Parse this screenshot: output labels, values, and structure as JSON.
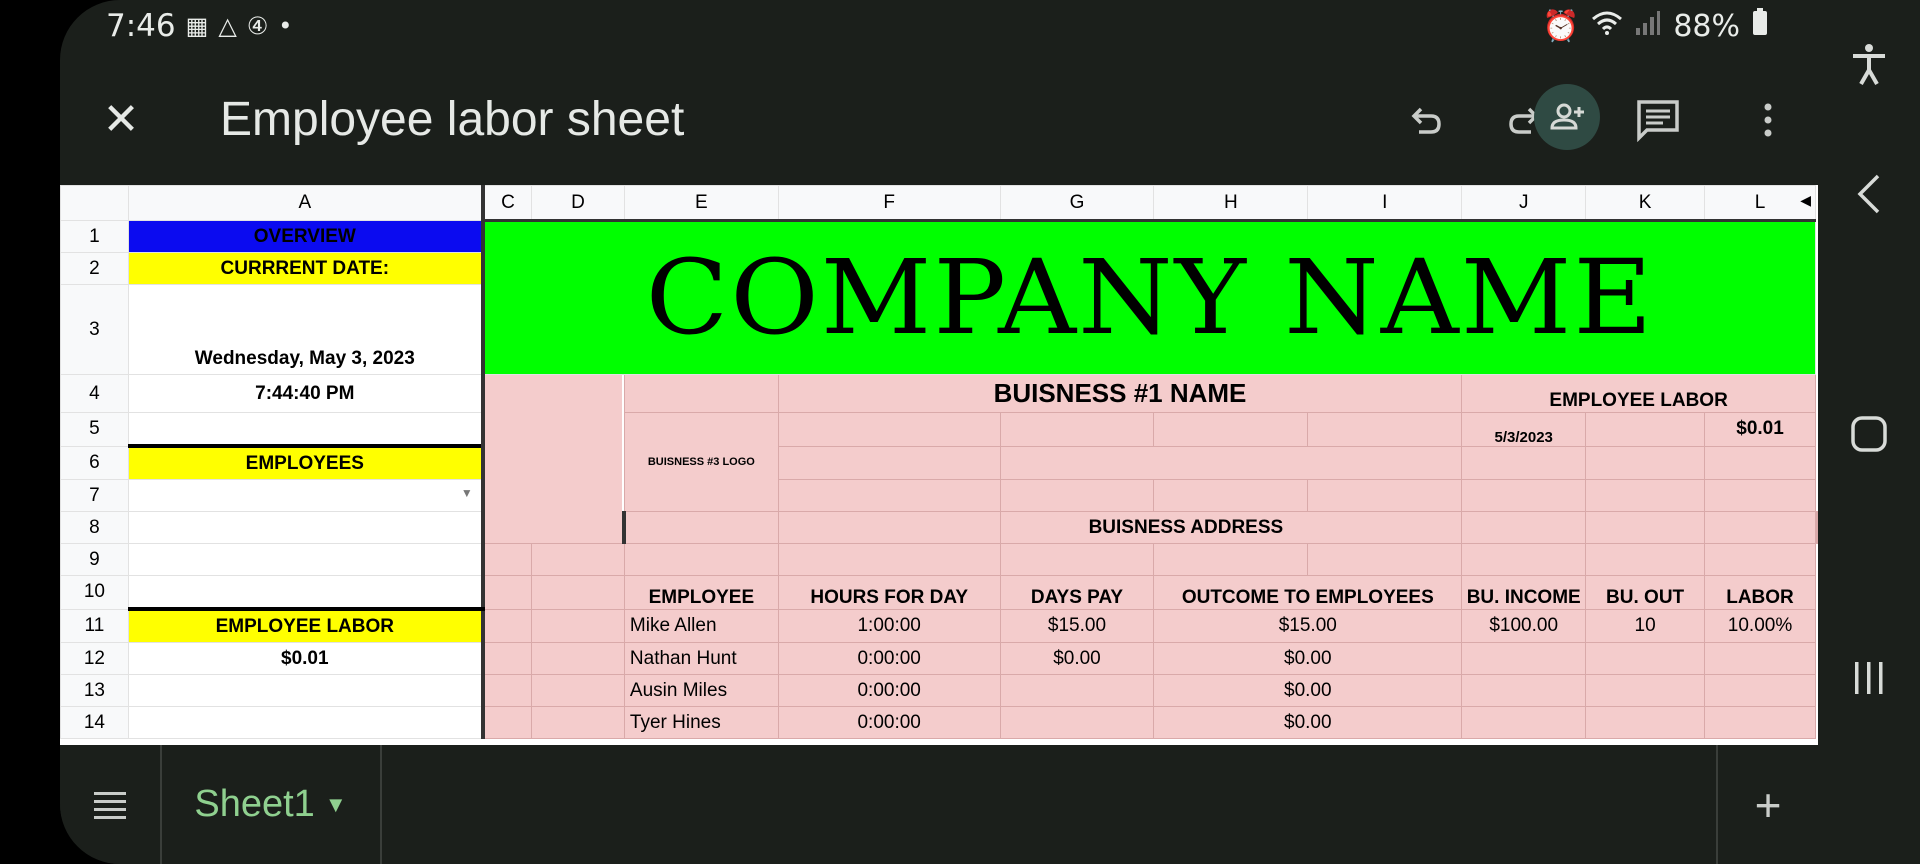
{
  "status_bar": {
    "time": "7:46",
    "battery": "88%",
    "left_icons": [
      "gallery-icon",
      "drive-icon",
      "notification-4-icon",
      "dot-icon"
    ],
    "right_icons": [
      "alarm-icon",
      "wifi-icon",
      "signal-icon",
      "battery-icon"
    ]
  },
  "toolbar": {
    "title": "Employee labor sheet",
    "icons": [
      "close-icon",
      "undo-icon",
      "redo-icon",
      "add-person-icon",
      "comment-icon",
      "more-vert-icon"
    ]
  },
  "columns": [
    "A",
    "C",
    "D",
    "E",
    "F",
    "G",
    "H",
    "I",
    "J",
    "K",
    "L"
  ],
  "rows": [
    "1",
    "2",
    "3",
    "4",
    "5",
    "6",
    "7",
    "8",
    "9",
    "10",
    "11",
    "12",
    "13",
    "14"
  ],
  "left_panel": {
    "overview": "OVERVIEW",
    "current_date_label": "CURRRENT DATE:",
    "date": "Wednesday, May 3, 2023",
    "time": "7:44:40 PM",
    "employees_label": "EMPLOYEES",
    "employee_labor_label": "EMPLOYEE LABOR",
    "employee_labor_value": "$0.01"
  },
  "banner": {
    "company_name": "COMPANY NAME"
  },
  "business": {
    "name": "BUISNESS #1 NAME",
    "logo": "BUISNESS #3 LOGO",
    "address": "BUISNESS ADDRESS",
    "labor_title": "EMPLOYEE LABOR",
    "labor_date": "5/3/2023",
    "labor_value": "$0.01"
  },
  "table": {
    "headers": [
      "EMPLOYEE",
      "HOURS FOR DAY",
      "DAYS PAY",
      "OUTCOME TO EMPLOYEES",
      "BU. INCOME",
      "BU. OUT",
      "LABOR"
    ],
    "rows": [
      [
        "Mike Allen",
        "1:00:00",
        "$15.00",
        "$15.00",
        "$100.00",
        "10",
        "10.00%"
      ],
      [
        "Nathan Hunt",
        "0:00:00",
        "$0.00",
        "$0.00",
        "",
        "",
        ""
      ],
      [
        "Ausin Miles",
        "0:00:00",
        "",
        "$0.00",
        "",
        "",
        ""
      ],
      [
        "Tyer Hines",
        "0:00:00",
        "",
        "$0.00",
        "",
        "",
        ""
      ]
    ]
  },
  "bottom": {
    "sheet_name": "Sheet1",
    "icons": [
      "sheet-list-icon",
      "add-sheet-icon"
    ]
  },
  "nav_icons": [
    "accessibility-icon",
    "back-icon",
    "home-icon",
    "recents-icon"
  ],
  "colors": {
    "overview_bg": "#0b0bf0",
    "label_bg": "#ffff00",
    "banner_bg": "#00ff00",
    "table_bg": "#f4cccc",
    "app_bg": "#1b1f1b",
    "sheet_tab": "#8fd08f"
  }
}
